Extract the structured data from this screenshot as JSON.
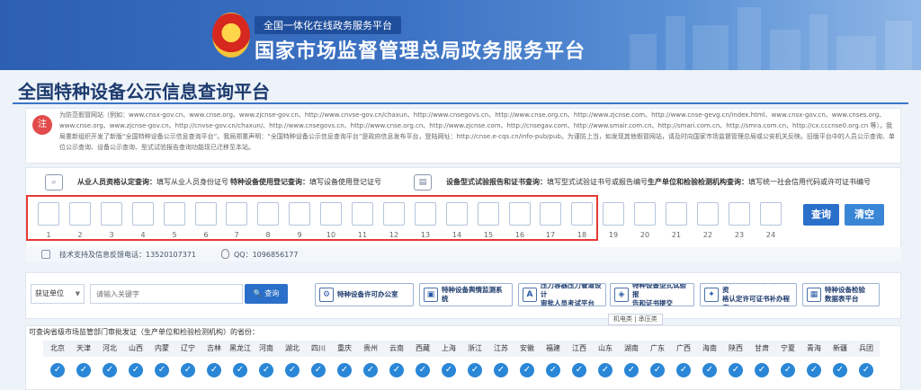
{
  "header": {
    "tag": "全国一体化在线政务服务平台",
    "title": "国家市场监督管理总局政务服务平台"
  },
  "page": {
    "title": "全国特种设备公示信息查询平台"
  },
  "notice": {
    "text": "为防范假冒网站（例如：www.cnsx-gov.cn、www.cnse.org、www.zjcnse-gov.cn、http://www.cnvse-gov.cn/chaxun、http://www.cnsegovs.cn、http://www.cnse.org.cn、http://www.zjcnse.com、http://www.cnse-gevg.cn/index.html、www.cnsx-gov.cn、www.cnses.org、www.cnse.org、www.zjcnse-gov.cn、http://cnvse-gov.cn/chaxun/、http://www.cnsegovs.cn、http://www.cnse.org.cn、http://www.zjcnse.com、http://cnsegav.com、http://www.smair.com.cn、http://smari.com.cn、http://smra.com.cn、http://cx.cccnse0.org.cn 等），我局重新组织开发了新版“全国特种设备公示信息查询平台”。我局郑重声明：“全国特种设备公示信息查询平台”是政府信息发布平台，登陆网址：http://cnse.e-cqs.cn/info-pub/pub。为谨防上当，如发现其他假冒网站，请及时向国家市场监督管理总局或公安机关反映。旧版平台中的人员公示查询、单位公示查询、设备公示查询、型式试验报告查询功能现已迁移至本站。"
  },
  "query": {
    "groups": [
      {
        "icon": "person-id-icon",
        "label": "从业人员资格认定查询：",
        "hint": "填写从业人员身份证号"
      },
      {
        "icon": "",
        "label": "特种设备使用登记查询：",
        "hint": "填写设备使用登记证号"
      },
      {
        "icon": "report-icon",
        "label": "设备型式试验报告和证书查询：",
        "hint": "填写型式试验证书号或报告编号"
      },
      {
        "icon": "",
        "label": "生产单位和检验检测机构查询：",
        "hint": "填写统一社会信用代码或许可证书编号"
      }
    ],
    "digits": [
      "1",
      "2",
      "3",
      "4",
      "5",
      "6",
      "7",
      "8",
      "9",
      "10",
      "11",
      "12",
      "13",
      "14",
      "15",
      "16",
      "17",
      "18",
      "19",
      "20",
      "21",
      "22",
      "23",
      "24"
    ],
    "query_label": "查询",
    "clear_label": "清空"
  },
  "support": {
    "phone": "技术支持及信息反馈电话：13520107371",
    "qq": "QQ：1096856177"
  },
  "search": {
    "select_value": "获证单位",
    "placeholder": "请输入关键字",
    "button_label": "查询",
    "links": [
      {
        "icon": "gear-tool-icon",
        "label": "特种设备许可办公室"
      },
      {
        "icon": "monitor-icon",
        "label": "特种设备舆情监测系统"
      },
      {
        "icon": "a-letter-icon",
        "label": "压力容器压力管道设计\n审批人员考试平台"
      },
      {
        "icon": "cube-icon",
        "label": "特种设备型式试验报\n告和证书提交"
      },
      {
        "icon": "inspect-icon",
        "label": "特种设备检验检测人员资\n格认定许可证书补办程序"
      },
      {
        "icon": "data-icon",
        "label": "特种设备检验\n数据表平台"
      }
    ],
    "tag_note": "机电类 | 承压类"
  },
  "provinces": {
    "caption": "可查询省级市场监管部门审批发证（生产单位和检验检测机构）的省份：",
    "names": [
      "北京",
      "天津",
      "河北",
      "山西",
      "内蒙",
      "辽宁",
      "吉林",
      "黑龙江",
      "河南",
      "湖北",
      "四川",
      "重庆",
      "贵州",
      "云南",
      "西藏",
      "上海",
      "浙江",
      "江苏",
      "安徽",
      "福建",
      "江西",
      "山东",
      "湖南",
      "广东",
      "广西",
      "海南",
      "陕西",
      "甘肃",
      "宁夏",
      "青海",
      "新疆",
      "兵团"
    ]
  }
}
